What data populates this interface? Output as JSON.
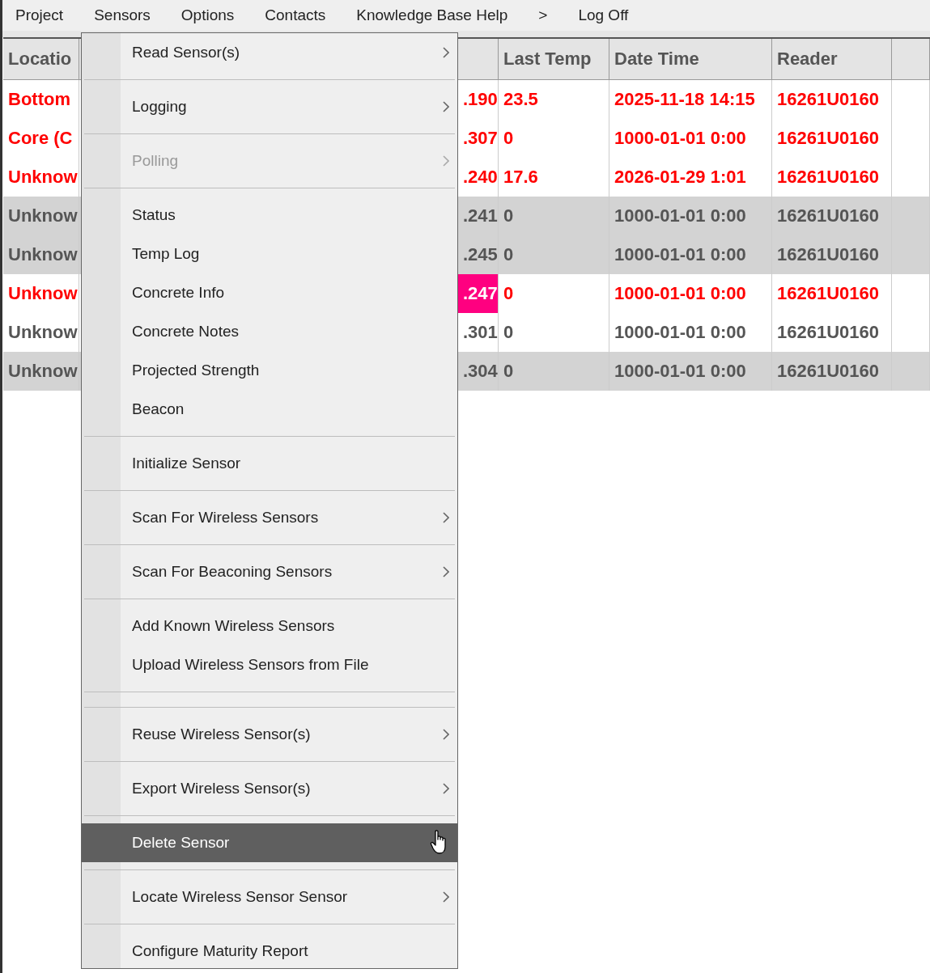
{
  "menubar": [
    {
      "label": "Project"
    },
    {
      "label": "Sensors"
    },
    {
      "label": "Options"
    },
    {
      "label": "Contacts"
    },
    {
      "label": "Knowledge Base Help"
    },
    {
      "label": ">"
    },
    {
      "label": "Log Off"
    }
  ],
  "table": {
    "columns": [
      "Locatio",
      "",
      "Last Temp",
      "Date Time",
      "Reader"
    ],
    "rows": [
      {
        "cells": [
          "Bottom",
          ".190",
          "23.5",
          "2025-11-18 14:15",
          "16261U0160"
        ],
        "alert": true,
        "shaded": false,
        "flagged": false
      },
      {
        "cells": [
          "Core (C",
          ".307",
          "0",
          "1000-01-01 0:00",
          "16261U0160"
        ],
        "alert": true,
        "shaded": false,
        "flagged": false
      },
      {
        "cells": [
          "Unknow",
          ".240",
          "17.6",
          "2026-01-29 1:01",
          "16261U0160"
        ],
        "alert": true,
        "shaded": false,
        "flagged": false
      },
      {
        "cells": [
          "Unknow",
          ".241",
          "0",
          "1000-01-01 0:00",
          "16261U0160"
        ],
        "alert": false,
        "shaded": true,
        "flagged": false
      },
      {
        "cells": [
          "Unknow",
          ".245",
          "0",
          "1000-01-01 0:00",
          "16261U0160"
        ],
        "alert": false,
        "shaded": true,
        "flagged": false
      },
      {
        "cells": [
          "Unknow",
          ".247",
          "0",
          "1000-01-01 0:00",
          "16261U0160"
        ],
        "alert": true,
        "shaded": false,
        "flagged": true
      },
      {
        "cells": [
          "Unknow",
          ".301",
          "0",
          "1000-01-01 0:00",
          "16261U0160"
        ],
        "alert": false,
        "shaded": false,
        "flagged": false
      },
      {
        "cells": [
          "Unknow",
          ".304",
          "0",
          "1000-01-01 0:00",
          "16261U0160"
        ],
        "alert": false,
        "shaded": true,
        "flagged": false
      }
    ]
  },
  "menu": {
    "items": [
      {
        "kind": "item",
        "label": "Read Sensor(s)",
        "submenu": true,
        "disabled": false,
        "selected": false
      },
      {
        "kind": "separator"
      },
      {
        "kind": "item",
        "label": "Logging",
        "submenu": true,
        "disabled": false,
        "selected": false
      },
      {
        "kind": "separator"
      },
      {
        "kind": "item",
        "label": "Polling",
        "submenu": true,
        "disabled": true,
        "selected": false
      },
      {
        "kind": "separator"
      },
      {
        "kind": "item",
        "label": "Status",
        "submenu": false,
        "disabled": false,
        "selected": false
      },
      {
        "kind": "item",
        "label": "Temp Log",
        "submenu": false,
        "disabled": false,
        "selected": false
      },
      {
        "kind": "item",
        "label": "Concrete Info",
        "submenu": false,
        "disabled": false,
        "selected": false
      },
      {
        "kind": "item",
        "label": "Concrete Notes",
        "submenu": false,
        "disabled": false,
        "selected": false
      },
      {
        "kind": "item",
        "label": "Projected Strength",
        "submenu": false,
        "disabled": false,
        "selected": false
      },
      {
        "kind": "item",
        "label": "Beacon",
        "submenu": false,
        "disabled": false,
        "selected": false
      },
      {
        "kind": "separator"
      },
      {
        "kind": "item",
        "label": "Initialize Sensor",
        "submenu": false,
        "disabled": false,
        "selected": false
      },
      {
        "kind": "separator"
      },
      {
        "kind": "item",
        "label": "Scan For Wireless Sensors",
        "submenu": true,
        "disabled": false,
        "selected": false
      },
      {
        "kind": "separator"
      },
      {
        "kind": "item",
        "label": "Scan For Beaconing Sensors",
        "submenu": true,
        "disabled": false,
        "selected": false
      },
      {
        "kind": "separator"
      },
      {
        "kind": "item",
        "label": "Add Known Wireless Sensors",
        "submenu": false,
        "disabled": false,
        "selected": false
      },
      {
        "kind": "item",
        "label": "Upload Wireless Sensors from File",
        "submenu": false,
        "disabled": false,
        "selected": false
      },
      {
        "kind": "separator"
      },
      {
        "kind": "separator"
      },
      {
        "kind": "item",
        "label": "Reuse Wireless Sensor(s)",
        "submenu": true,
        "disabled": false,
        "selected": false
      },
      {
        "kind": "separator"
      },
      {
        "kind": "item",
        "label": "Export Wireless Sensor(s)",
        "submenu": true,
        "disabled": false,
        "selected": false
      },
      {
        "kind": "separator"
      },
      {
        "kind": "item",
        "label": "Delete Sensor",
        "submenu": false,
        "disabled": false,
        "selected": true
      },
      {
        "kind": "separator"
      },
      {
        "kind": "item",
        "label": "Locate Wireless Sensor Sensor",
        "submenu": true,
        "disabled": false,
        "selected": false
      },
      {
        "kind": "separator"
      },
      {
        "kind": "item",
        "label": "Configure Maturity Report",
        "submenu": false,
        "disabled": false,
        "selected": false
      }
    ]
  }
}
